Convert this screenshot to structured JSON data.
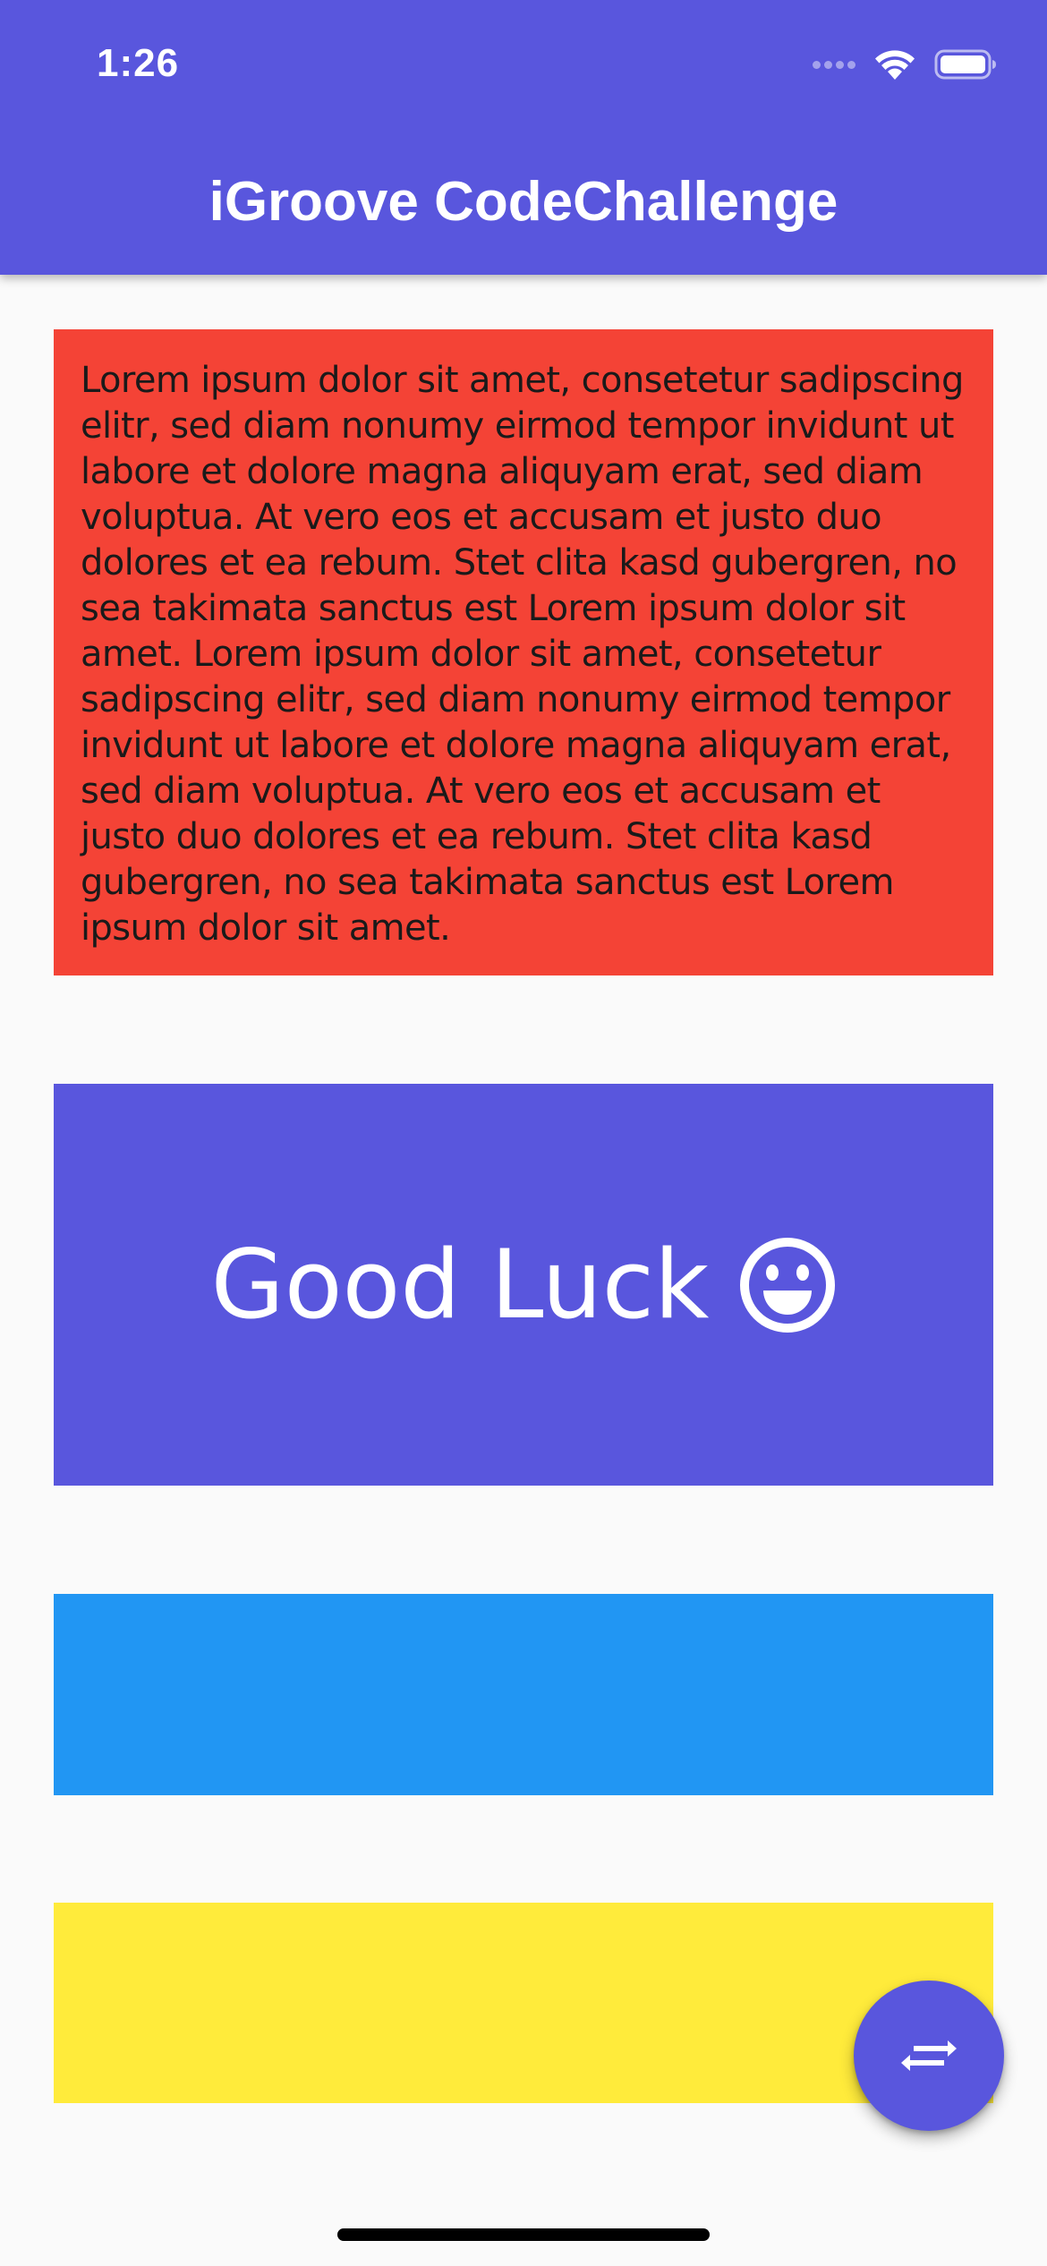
{
  "status_bar": {
    "time": "1:26"
  },
  "app_bar": {
    "title": "iGroove CodeChallenge"
  },
  "cards": {
    "text_card": {
      "text": "Lorem ipsum dolor sit amet, consetetur sadipscing elitr, sed diam nonumy eirmod tempor invidunt ut labore et dolore magna aliquyam erat, sed diam voluptua. At vero eos et accusam et justo duo dolores et ea rebum. Stet clita kasd gubergren, no sea takimata sanctus est Lorem ipsum dolor sit amet. Lorem ipsum dolor sit amet, consetetur sadipscing elitr, sed diam nonumy eirmod tempor invidunt ut labore et dolore magna aliquyam erat, sed diam voluptua. At vero eos et accusam et justo duo dolores et ea rebum. Stet clita kasd gubergren, no sea takimata sanctus est Lorem ipsum dolor sit amet.",
      "color": "#f44336"
    },
    "greeting_card": {
      "label": "Good Luck",
      "icon": "smiley-face-icon",
      "color": "#5956dd"
    },
    "blue_card": {
      "color": "#2196f3"
    },
    "yellow_card": {
      "color": "#ffeb3b"
    }
  },
  "fab": {
    "icon": "swap-horizontal-icon"
  },
  "colors": {
    "primary": "#5956dd",
    "background": "#fafafa"
  }
}
